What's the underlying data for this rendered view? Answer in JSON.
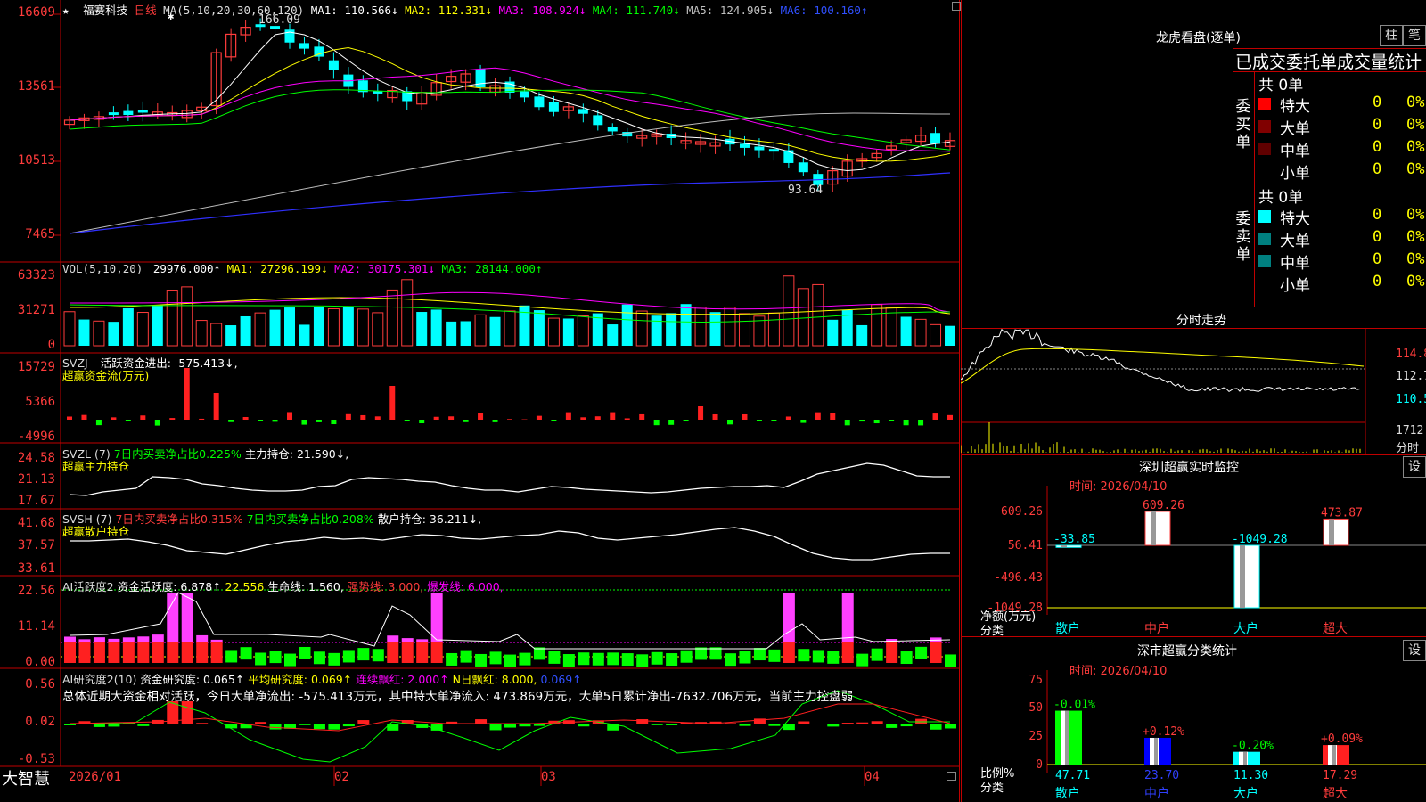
{
  "app": {
    "logo": "大智慧",
    "stock_name": "福赛科技",
    "period": "日线",
    "star": "★"
  },
  "colors": {
    "up": "#ff3c3c",
    "down": "#00ffff",
    "ma1": "#ffffff",
    "ma2": "#ffff00",
    "ma3": "#ff00ff",
    "ma4": "#00ff00",
    "ma5": "#c0c0c0",
    "ma6": "#3030ff",
    "frame": "#c00000"
  },
  "kline": {
    "header": {
      "ma_label": "MA(5,10,20,30,60,120)",
      "ma1": "MA1: 110.566↓",
      "ma2": "MA2: 112.331↓",
      "ma3": "MA3: 108.924↓",
      "ma4": "MA4: 111.740↓",
      "ma5": "MA5: 124.905↓",
      "ma6": "MA6: 100.160↑"
    },
    "y_ticks": [
      "16609",
      "13561",
      "10513",
      "7465"
    ],
    "high_mark": "166.09",
    "low_mark": "93.64"
  },
  "vol": {
    "header": {
      "label": "VOL(5,10,20)",
      "value": "29976.000↑",
      "ma1": "MA1: 27296.199↓",
      "ma2": "MA2: 30175.301↓",
      "ma3": "MA3: 28144.000↑"
    },
    "y_ticks": [
      "63323",
      "31271",
      "0"
    ]
  },
  "svzj": {
    "header": {
      "label": "SVZJ",
      "text": "活跃资金进出: -575.413↓,",
      "title": "超赢资金流(万元)"
    },
    "y_ticks": [
      "15729",
      "5366",
      "-4996"
    ]
  },
  "svzl": {
    "header": {
      "label": "SVZL (7)",
      "a": "7日内买卖净占比0.225%",
      "b": "主力持仓: 21.590↓,",
      "title": "超赢主力持仓"
    },
    "y_ticks": [
      "24.58",
      "21.13",
      "17.67"
    ]
  },
  "svsh": {
    "header": {
      "label": "SVSH (7)",
      "a": "7日内买卖净占比0.315%",
      "b": "7日内买卖净占比0.208%",
      "c": "散户持仓: 36.211↓,",
      "title": "超赢散户持仓"
    },
    "y_ticks": [
      "41.68",
      "37.57",
      "33.61"
    ]
  },
  "ai1": {
    "header": {
      "label": "AI活跃度2",
      "a": "资金活跃度: 6.878↑",
      "b": "22.556",
      "c": "生命线: 1.560,",
      "d": "强势线: 3.000,",
      "e": "爆发线: 6.000,"
    },
    "y_ticks": [
      "22.56",
      "11.14",
      "0.00"
    ]
  },
  "ai2": {
    "header": {
      "label": "AI研究度2(10)",
      "a": "资金研究度: 0.065↑",
      "b": "平均研究度: 0.069↑",
      "c": "连续飘红: 2.000↑",
      "d": "N日飘红: 8.000,",
      "e": "0.069↑"
    },
    "summary": "总体近期大资金相对活跃，今日大单净流出: -575.413万元，其中特大单净流入: 473.869万元，大单5日累计净出-7632.706万元，当前主力控盘弱",
    "y_ticks": [
      "0.56",
      "0.02",
      "-0.53"
    ]
  },
  "x_axis": [
    "2026/01",
    "02",
    "03",
    "04"
  ],
  "longhu": {
    "title": "龙虎看盘(逐单)",
    "btn_a": "柱",
    "btn_b": "笔",
    "subtitle": "已成交委托单成交量统计",
    "buy_label": "委买单",
    "sell_label": "委卖单",
    "buy_total": "共 0单",
    "sell_total": "共 0单",
    "buy_rows": [
      {
        "name": "特大",
        "count": "0",
        "pct": "0%"
      },
      {
        "name": "大单",
        "count": "0",
        "pct": "0%"
      },
      {
        "name": "中单",
        "count": "0",
        "pct": "0%"
      },
      {
        "name": "小单",
        "count": "0",
        "pct": "0%"
      }
    ],
    "sell_rows": [
      {
        "name": "特大",
        "count": "0",
        "pct": "0%"
      },
      {
        "name": "大单",
        "count": "0",
        "pct": "0%"
      },
      {
        "name": "中单",
        "count": "0",
        "pct": "0%"
      },
      {
        "name": "小单",
        "count": "0",
        "pct": "0%"
      }
    ]
  },
  "intraday": {
    "title": "分时走势",
    "prices": [
      "114.8",
      "112.7",
      "110.5"
    ],
    "vol": "1712",
    "vol_unit": "分时"
  },
  "sz_monitor": {
    "title": "深圳超赢实时监控",
    "settings": "设",
    "time": "时间: 2026/04/10",
    "y_ticks": [
      "609.26",
      "56.41",
      "-496.43",
      "-1049.28"
    ],
    "unit_label": "净额(万元)",
    "cat_label": "分类",
    "chart_data": {
      "type": "bar",
      "categories": [
        "散户",
        "中户",
        "大户",
        "超大"
      ],
      "values": [
        -33.85,
        609.26,
        -1049.28,
        473.87
      ],
      "labels": [
        "-33.85",
        "609.26",
        "-1049.28",
        "473.87"
      ],
      "ylim": [
        -1049.28,
        609.26
      ]
    }
  },
  "sz_class": {
    "title": "深市超赢分类统计",
    "settings": "设",
    "time": "时间: 2026/04/10",
    "y_ticks": [
      "75",
      "50",
      "25",
      "0"
    ],
    "unit_label": "比例%",
    "cat_label": "分类",
    "chart_data": {
      "type": "bar",
      "categories": [
        "散户",
        "中户",
        "大户",
        "超大"
      ],
      "values": [
        47.71,
        23.7,
        11.3,
        17.29
      ],
      "value_labels": [
        "47.71",
        "23.70",
        "11.30",
        "17.29"
      ],
      "change_labels": [
        "-0.01%",
        "+0.12%",
        "-0.20%",
        "+0.09%"
      ],
      "ylim": [
        0,
        75
      ]
    }
  }
}
